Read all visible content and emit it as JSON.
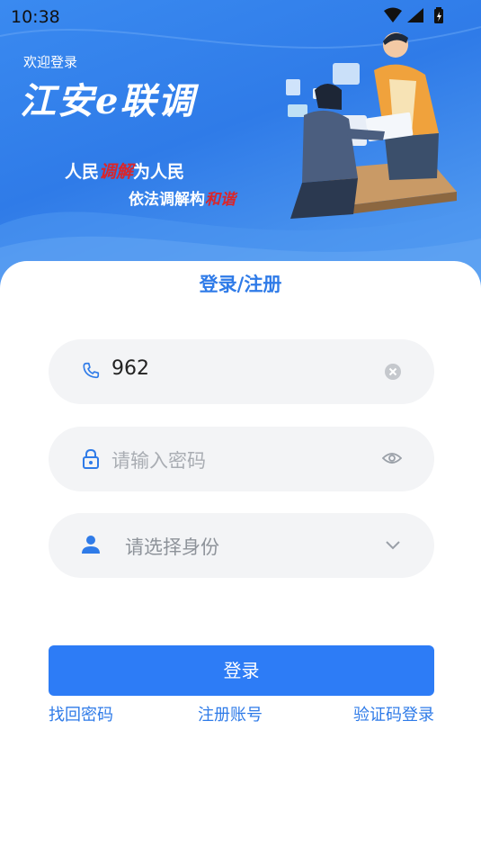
{
  "status_bar": {
    "time": "10:38"
  },
  "hero": {
    "welcome": "欢迎登录",
    "app_title": "江安e联调",
    "slogan_line1_a": "人民",
    "slogan_line1_hl": "调解",
    "slogan_line1_b": "为人民",
    "slogan_line2_a": "依法调解构",
    "slogan_line2_hl": "和谐"
  },
  "form": {
    "title": "登录/注册",
    "phone_value": "962",
    "password_placeholder": "请输入密码",
    "identity_placeholder": "请选择身份",
    "login_label": "登录"
  },
  "links": {
    "forgot_password": "找回密码",
    "register": "注册账号",
    "sms_login": "验证码登录"
  },
  "colors": {
    "primary": "#2d7cf6",
    "hero": "#3a8af0",
    "field_bg": "#f3f4f6",
    "accent_red": "#d9262b"
  }
}
